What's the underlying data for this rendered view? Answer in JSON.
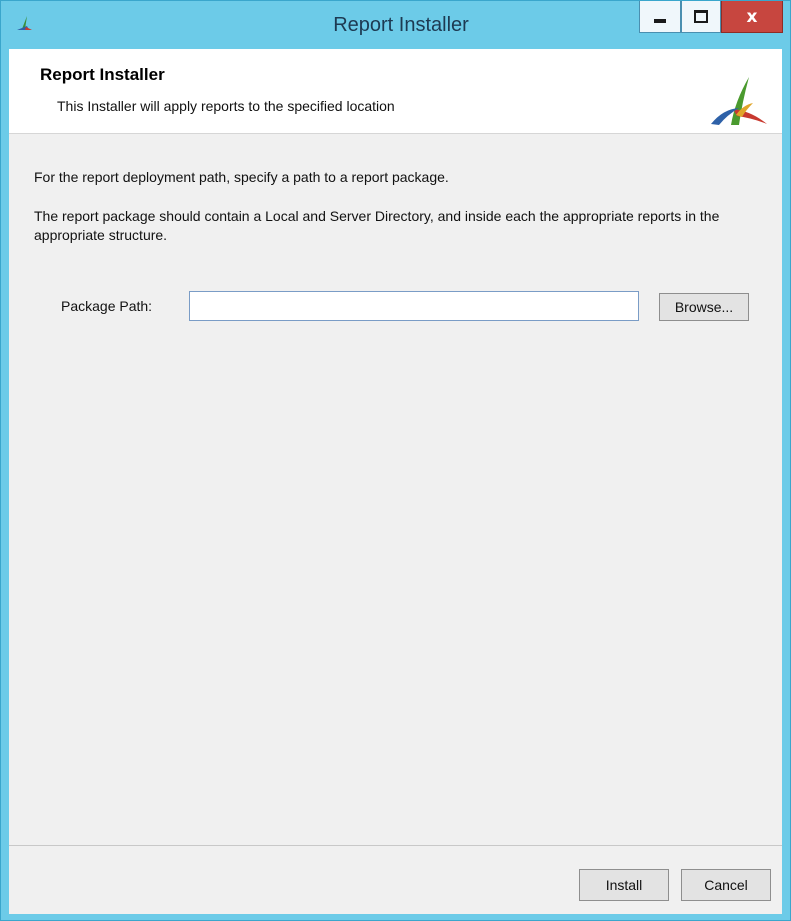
{
  "window": {
    "title": "Report Installer",
    "controls": {
      "minimize_icon": "minimize-icon",
      "maximize_icon": "maximize-icon",
      "close_icon": "close-icon",
      "close_glyph": "x"
    },
    "colors": {
      "frame": "#6ccbe8",
      "close_button": "#c7463f",
      "client_background": "#f0f0f0"
    }
  },
  "banner": {
    "title": "Report Installer",
    "subtitle": "This Installer will apply reports to the specified location",
    "logo_icon": "installer-logo-icon"
  },
  "instructions": {
    "line1": "For the report deployment path, specify a path to a report package.",
    "line2": "The report package should contain a Local and Server Directory, and inside each the appropriate reports in the appropriate structure."
  },
  "form": {
    "package_path_label": "Package Path:",
    "package_path_value": "",
    "browse_label": "Browse..."
  },
  "footer": {
    "install_label": "Install",
    "cancel_label": "Cancel"
  }
}
